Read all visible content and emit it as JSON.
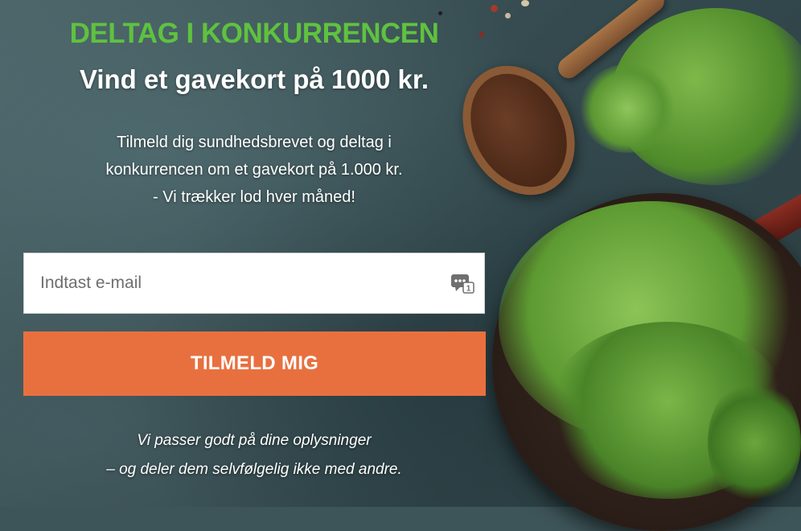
{
  "headline": "DELTAG I KONKURRENCEN",
  "subheadline": "Vind et gavekort på 1000 kr.",
  "intro": {
    "line1": "Tilmeld dig sundhedsbrevet og deltag i",
    "line2": "konkurrencen om et gavekort på 1.000 kr.",
    "line3": "- Vi trækker lod hver måned!"
  },
  "form": {
    "email_placeholder": "Indtast e-mail",
    "email_value": "",
    "submit_label": "TILMELD MIG",
    "autofill_icon": "password-manager-icon"
  },
  "privacy": {
    "line1": "Vi passer godt på dine oplysninger",
    "line2": "– og deler dem selvfølgelig ikke med andre."
  },
  "colors": {
    "headline": "#5fc23f",
    "button": "#e8703f",
    "text": "#ffffff",
    "background": "#3d5458"
  }
}
